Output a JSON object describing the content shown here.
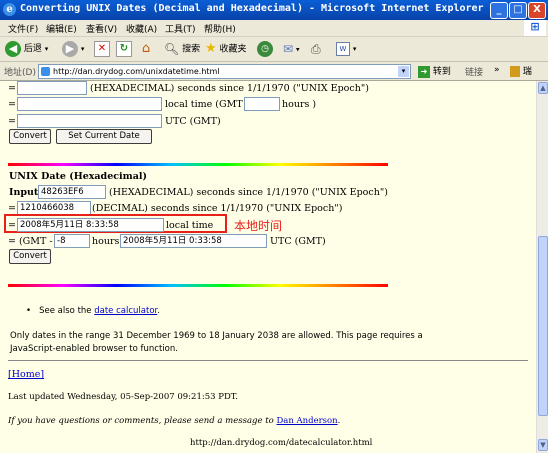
{
  "window": {
    "title": "Converting UNIX Dates (Decimal and Hexadecimal) - Microsoft Internet Explorer",
    "min_label": "_",
    "max_label": "□",
    "close_label": "X"
  },
  "menu": [
    "文件(F)",
    "编辑(E)",
    "查看(V)",
    "收藏(A)",
    "工具(T)",
    "帮助(H)"
  ],
  "toolbar": {
    "back_label": "后退",
    "search_label": "搜索",
    "favorites_label": "收藏夹"
  },
  "address": {
    "label": "地址(D)",
    "url": "http://dan.drydog.com/unixdatetime.html",
    "go_label": "转到",
    "links_label": "链接",
    "extra_label": "瑞"
  },
  "top_section": {
    "row1_prefix": "=",
    "row1_value": "",
    "row1_text": "(HEXADECIMAL) seconds since 1/1/1970 (\"UNIX Epoch\")",
    "row2_prefix": "=",
    "row2_value": "",
    "row2_text": "local time (GMT -",
    "row2_gmt_value": "",
    "row2_suffix": "hours )",
    "row3_prefix": "=",
    "row3_value": "",
    "row3_text": "UTC (GMT)",
    "convert_label": "Convert",
    "set_current_label": "Set Current Date"
  },
  "hex_section": {
    "heading": "UNIX Date (Hexadecimal)",
    "input_label": "Input:",
    "input_value": "48263EF6",
    "input_text": "(HEXADECIMAL) seconds since 1/1/1970 (\"UNIX Epoch\")",
    "dec_prefix": "=",
    "dec_value": "1210466038",
    "dec_text": "(DECIMAL) seconds since 1/1/1970 (\"UNIX Epoch\")",
    "local_prefix": "=",
    "local_value": "2008年5月11日  8:33:58",
    "local_text": "local time",
    "annotation": "本地时间",
    "gmt_prefix": "= (GMT -",
    "gmt_value": "-8",
    "gmt_hours": "hours)",
    "utc_value": "2008年5月11日  0:33:58",
    "utc_text": "UTC (GMT)",
    "convert_label": "Convert"
  },
  "footer": {
    "see_also_prefix": "See also the",
    "see_also_link": "date calculator",
    "see_also_suffix": ".",
    "range_text_line1": "Only dates in the range 31 December 1969 to 18 January 2038 are allowed. This page requires a",
    "range_text_line2": "JavaScript-enabled browser to function.",
    "home_link": "[Home]",
    "updated": "Last updated Wednesday, 05-Sep-2007 09:21:53 PDT.",
    "contact_prefix": "If you have questions or comments, please send a message to",
    "contact_link": "Dan Anderson",
    "contact_suffix": ".",
    "bottom_url": "http://dan.drydog.com/datecalculator.html"
  },
  "colors": {
    "annotation_red": "#e8201a",
    "page_bg": "#ffffe8",
    "title_blue": "#0842a8"
  }
}
